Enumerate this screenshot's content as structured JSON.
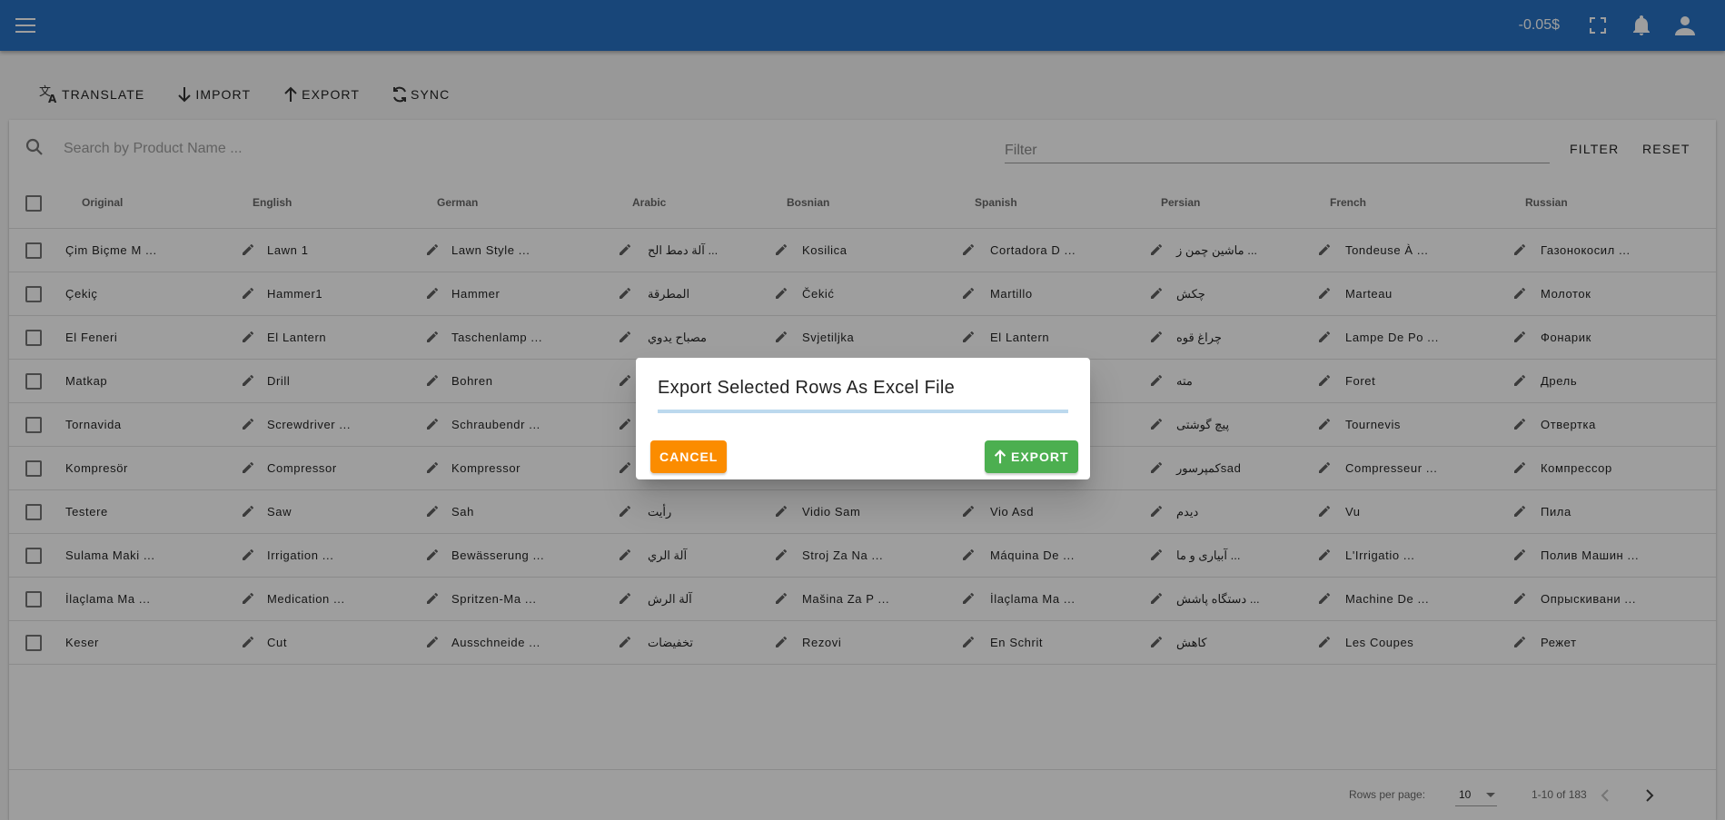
{
  "appbar": {
    "balance": "-0.05$",
    "icons": [
      "menu-icon",
      "fullscreen-icon",
      "bell-icon",
      "account-icon"
    ],
    "color": "#2872c4"
  },
  "toolbar": {
    "translate": "TRANSLATE",
    "import": "IMPORT",
    "export": "EXPORT",
    "sync": "SYNC"
  },
  "search": {
    "placeholder": "Search by Product Name ...",
    "filter_placeholder": "Filter",
    "filter_button": "FILTER",
    "reset_button": "RESET"
  },
  "columns": [
    "Original",
    "English",
    "German",
    "Arabic",
    "Bosnian",
    "Spanish",
    "Persian",
    "French",
    "Russian"
  ],
  "rows": [
    {
      "original": "Çim Biçme M ...",
      "english": "Lawn 1",
      "german": "Lawn Style ...",
      "arabic": "آلة دمط الح ...",
      "bosnian": "Kosilica",
      "spanish": "Cortadora D ...",
      "persian": "ماشین چمن ز ...",
      "french": "Tondeuse À ...",
      "russian": "Газонокосил ..."
    },
    {
      "original": "Çekiç",
      "english": "Hammer1",
      "german": "Hammer",
      "arabic": "المطرقة",
      "bosnian": "Čekić",
      "spanish": "Martillo",
      "persian": "چکش",
      "french": "Marteau",
      "russian": "Молоток"
    },
    {
      "original": "El Feneri",
      "english": "El Lantern",
      "german": "Taschenlamp ...",
      "arabic": "مصباح يدوي",
      "bosnian": "Svjetiljka",
      "spanish": "El Lantern",
      "persian": "چراغ قوه",
      "french": "Lampe De Po ...",
      "russian": "Фонарик"
    },
    {
      "original": "Matkap",
      "english": "Drill",
      "german": "Bohren",
      "arabic": "",
      "bosnian": "",
      "spanish": "",
      "persian": "مته",
      "french": "Foret",
      "russian": "Дрель"
    },
    {
      "original": "Tornavida",
      "english": "Screwdriver ...",
      "german": "Schraubendr ...",
      "arabic": "",
      "bosnian": "",
      "spanish": "",
      "persian": "پیچ گوشتی",
      "french": "Tournevis",
      "russian": "Отвертка"
    },
    {
      "original": "Kompresör",
      "english": "Compressor",
      "german": "Kompressor",
      "arabic": "",
      "bosnian": "",
      "spanish": "",
      "persian": "کمپرسورsad",
      "french": "Compresseur ...",
      "russian": "Компрессор"
    },
    {
      "original": "Testere",
      "english": "Saw",
      "german": "Sah",
      "arabic": "رأيت",
      "bosnian": "Vidio Sam",
      "spanish": "Vio Asd",
      "persian": "دیدم",
      "french": "Vu",
      "russian": "Пила"
    },
    {
      "original": "Sulama Maki ...",
      "english": "Irrigation ...",
      "german": "Bewässerung ...",
      "arabic": "آلة الري",
      "bosnian": "Stroj Za Na ...",
      "spanish": "Máquina De ...",
      "persian": "آبیاری و ما ...",
      "french": "L'Irrigatio ...",
      "russian": "Полив Машин ..."
    },
    {
      "original": "İlaçlama Ma ...",
      "english": "Medication ...",
      "german": "Spritzen-Ma ...",
      "arabic": "آلة الرش",
      "bosnian": "Mašina Za P ...",
      "spanish": "İlaçlama Ma ...",
      "persian": "دستگاه پاشش ...",
      "french": "Machine De ...",
      "russian": "Опрыскивани ..."
    },
    {
      "original": "Keser",
      "english": "Cut",
      "german": "Ausschneide ...",
      "arabic": "تخفيضات",
      "bosnian": "Rezovi",
      "spanish": "En Schrit",
      "persian": "کاهش",
      "french": "Les Coupes",
      "russian": "Режет"
    }
  ],
  "footer": {
    "rows_per_page_label": "Rows per page:",
    "rows_per_page_value": "10",
    "range": "1-10 of 183"
  },
  "dialog": {
    "title": "Export Selected Rows As Excel File",
    "cancel": "CANCEL",
    "export": "EXPORT",
    "cancel_color": "#fb8c00",
    "export_color": "#4caf50"
  }
}
